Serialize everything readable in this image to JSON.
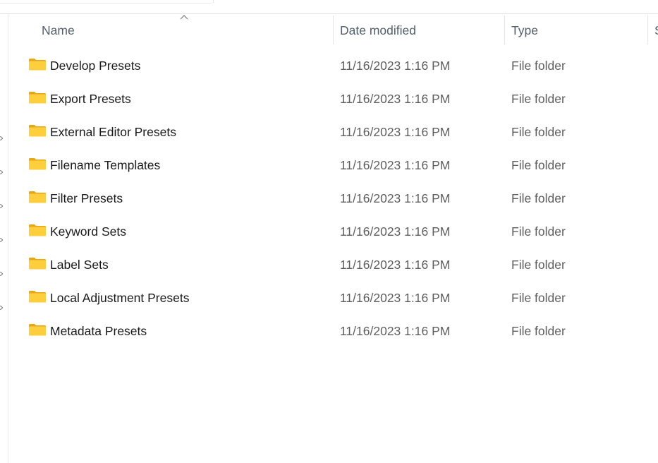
{
  "columns": {
    "name": "Name",
    "date_modified": "Date modified",
    "type": "Type",
    "size_partial": "S"
  },
  "sort": {
    "column": "Name",
    "direction": "ascending",
    "icon": "chevron-up-icon"
  },
  "folder_icon": "folder-icon",
  "colors": {
    "folder_body": "#FFCE3D",
    "folder_back": "#E8A712",
    "header_text": "#52606D",
    "meta_text": "#5F5F5F"
  },
  "rows": [
    {
      "name": "Develop Presets",
      "date": "11/16/2023 1:16 PM",
      "type": "File folder"
    },
    {
      "name": "Export Presets",
      "date": "11/16/2023 1:16 PM",
      "type": "File folder"
    },
    {
      "name": "External Editor Presets",
      "date": "11/16/2023 1:16 PM",
      "type": "File folder"
    },
    {
      "name": "Filename Templates",
      "date": "11/16/2023 1:16 PM",
      "type": "File folder"
    },
    {
      "name": "Filter Presets",
      "date": "11/16/2023 1:16 PM",
      "type": "File folder"
    },
    {
      "name": "Keyword Sets",
      "date": "11/16/2023 1:16 PM",
      "type": "File folder"
    },
    {
      "name": "Label Sets",
      "date": "11/16/2023 1:16 PM",
      "type": "File folder"
    },
    {
      "name": "Local Adjustment Presets",
      "date": "11/16/2023 1:16 PM",
      "type": "File folder"
    },
    {
      "name": "Metadata Presets",
      "date": "11/16/2023 1:16 PM",
      "type": "File folder"
    }
  ]
}
